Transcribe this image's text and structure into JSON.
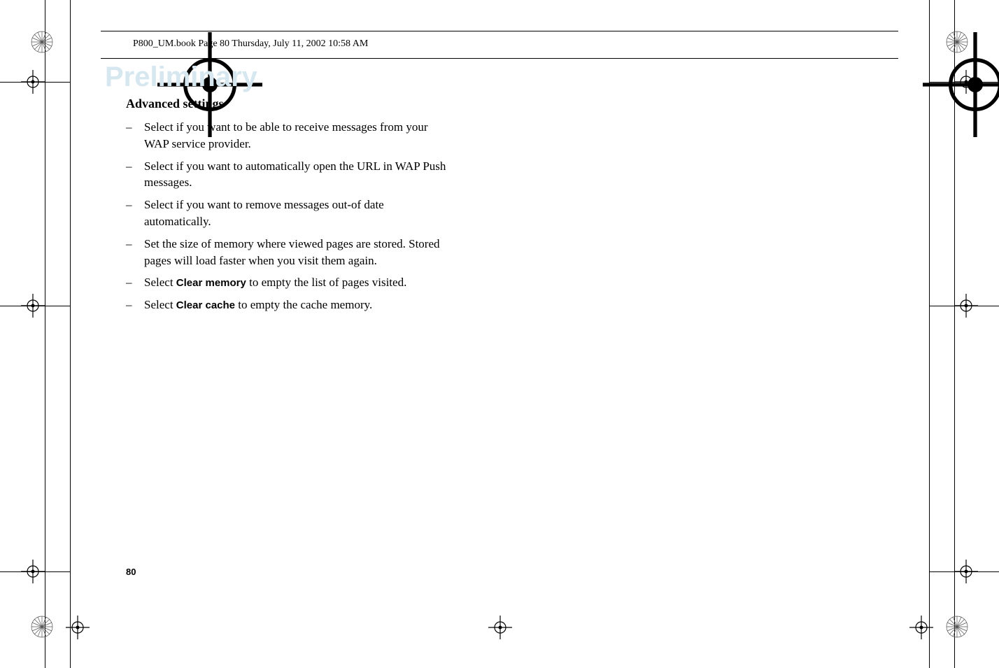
{
  "header": {
    "running_text": "P800_UM.book  Page 80  Thursday, July 11, 2002  10:58 AM"
  },
  "watermark": "Preliminary",
  "section_title": "Advanced settings",
  "bullets": [
    {
      "dash": "–",
      "pre": "Select if you want to be able to receive messages from your WAP service provider.",
      "term": "",
      "post": ""
    },
    {
      "dash": "–",
      "pre": "Select if you want to automatically open the URL in WAP Push messages.",
      "term": "",
      "post": ""
    },
    {
      "dash": "–",
      "pre": "Select if you want to remove messages out-of date automatically.",
      "term": "",
      "post": ""
    },
    {
      "dash": "–",
      "pre": "Set the size of memory where viewed pages are stored. Stored pages will load faster when you visit them again.",
      "term": "",
      "post": ""
    },
    {
      "dash": "–",
      "pre": "Select ",
      "term": "Clear memory",
      "post": " to empty the list of pages visited."
    },
    {
      "dash": "–",
      "pre": "Select ",
      "term": "Clear cache",
      "post": " to empty the cache memory."
    }
  ],
  "page_number": "80"
}
